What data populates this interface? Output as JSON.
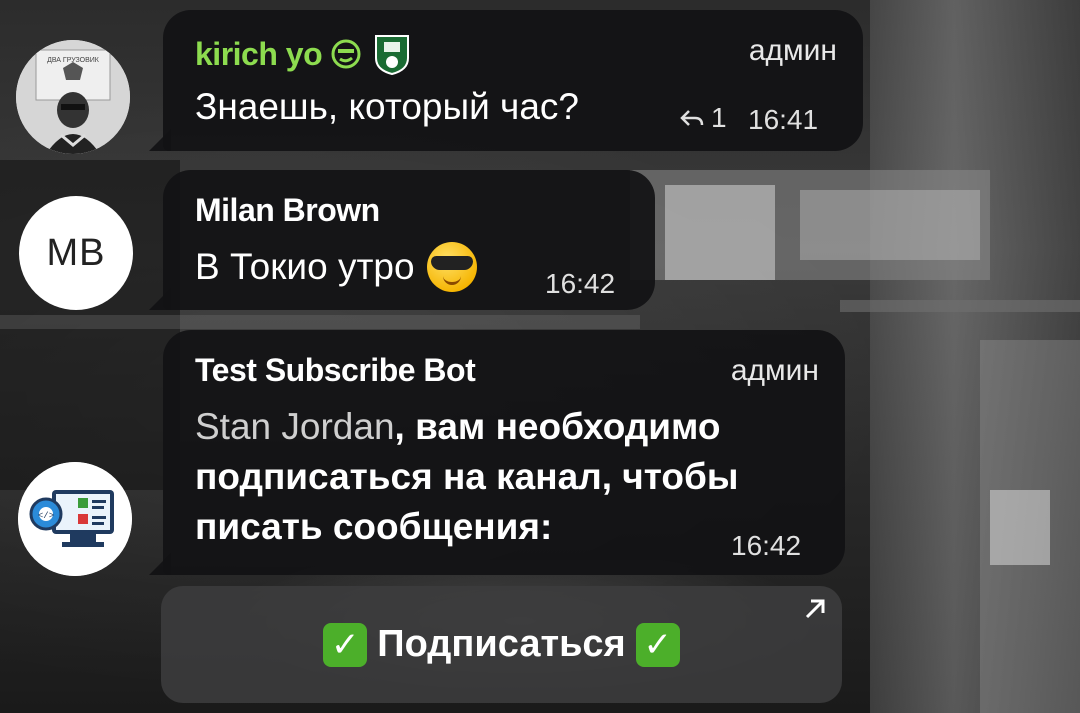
{
  "messages": [
    {
      "sender": "kirich yo",
      "role": "админ",
      "text": "Знаешь, который час?",
      "replies": "1",
      "time": "16:41",
      "name_color": "#8ddc4f"
    },
    {
      "sender": "Milan Brown",
      "avatar_initials": "MB",
      "text": "В Токио утро",
      "emoji": "smiling-face-with-sunglasses",
      "time": "16:42"
    },
    {
      "sender": "Test Subscribe Bot",
      "role": "админ",
      "mention": "Stan Jordan",
      "text": ", вам необходимо подписаться на канал, чтобы писать сообщения:",
      "time": "16:42"
    }
  ],
  "inline_button": {
    "label": "Подписаться",
    "accent": "#4caf2a"
  }
}
